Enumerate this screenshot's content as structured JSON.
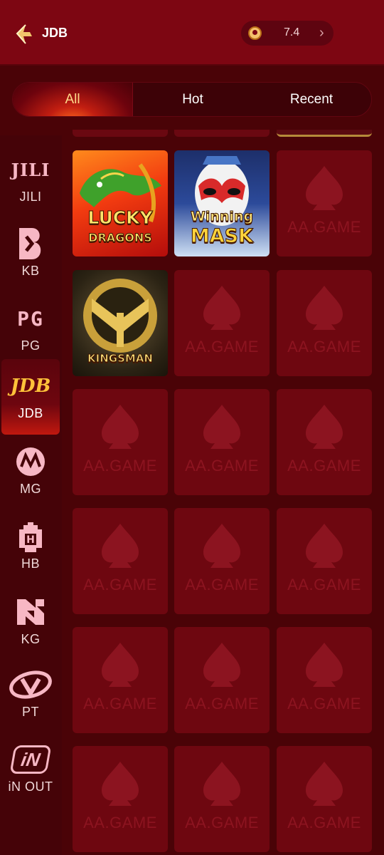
{
  "header": {
    "title": "JDB",
    "balance": "7.4"
  },
  "tabs": [
    {
      "label": "All",
      "active": true
    },
    {
      "label": "Hot",
      "active": false
    },
    {
      "label": "Recent",
      "active": false
    }
  ],
  "sidebar": {
    "items": [
      {
        "logo_text": "JILI",
        "label": "JILI",
        "active": false
      },
      {
        "logo_text": "KB",
        "label": "KB",
        "active": false
      },
      {
        "logo_text": "PG",
        "label": "PG",
        "active": false
      },
      {
        "logo_text": "JDB",
        "label": "JDB",
        "active": true
      },
      {
        "logo_text": "MG",
        "label": "MG",
        "active": false
      },
      {
        "logo_text": "H",
        "label": "HB",
        "active": false
      },
      {
        "logo_text": "KG",
        "label": "KG",
        "active": false
      },
      {
        "logo_text": "PT",
        "label": "PT",
        "active": false
      },
      {
        "logo_text": "iN",
        "label": "iN OUT",
        "active": false
      }
    ]
  },
  "games": {
    "lucky_dragons": {
      "line1": "LUCKY",
      "line2": "DRAGONS"
    },
    "winning_mask": {
      "line1": "Winning",
      "line2": "MASK"
    },
    "kingsman": {
      "line1": "KINGSMAN"
    },
    "placeholder_text": "AA.GAME"
  },
  "colors": {
    "header_bg": "#7d0612",
    "page_bg": "#4a0307",
    "accent_gold": "#ffd98a",
    "placeholder_card": "#6e0710"
  }
}
